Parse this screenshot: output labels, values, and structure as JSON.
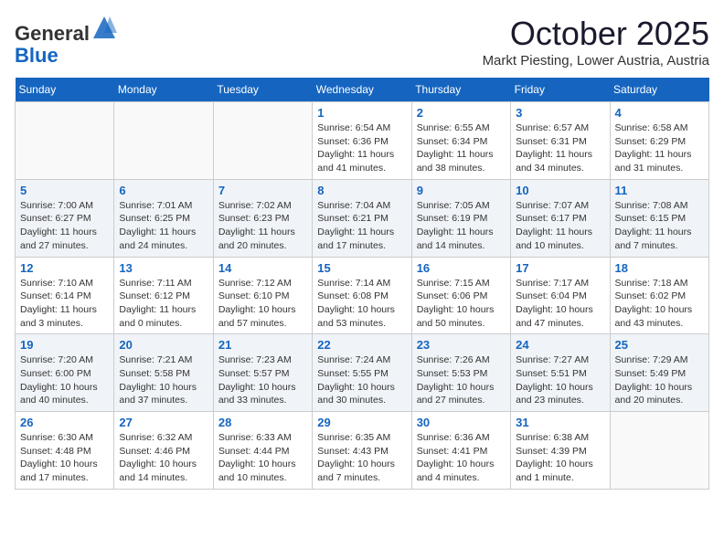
{
  "header": {
    "logo_general": "General",
    "logo_blue": "Blue",
    "month_title": "October 2025",
    "subtitle": "Markt Piesting, Lower Austria, Austria"
  },
  "weekdays": [
    "Sunday",
    "Monday",
    "Tuesday",
    "Wednesday",
    "Thursday",
    "Friday",
    "Saturday"
  ],
  "weeks": [
    [
      {
        "day": "",
        "info": ""
      },
      {
        "day": "",
        "info": ""
      },
      {
        "day": "",
        "info": ""
      },
      {
        "day": "1",
        "info": "Sunrise: 6:54 AM\nSunset: 6:36 PM\nDaylight: 11 hours\nand 41 minutes."
      },
      {
        "day": "2",
        "info": "Sunrise: 6:55 AM\nSunset: 6:34 PM\nDaylight: 11 hours\nand 38 minutes."
      },
      {
        "day": "3",
        "info": "Sunrise: 6:57 AM\nSunset: 6:31 PM\nDaylight: 11 hours\nand 34 minutes."
      },
      {
        "day": "4",
        "info": "Sunrise: 6:58 AM\nSunset: 6:29 PM\nDaylight: 11 hours\nand 31 minutes."
      }
    ],
    [
      {
        "day": "5",
        "info": "Sunrise: 7:00 AM\nSunset: 6:27 PM\nDaylight: 11 hours\nand 27 minutes."
      },
      {
        "day": "6",
        "info": "Sunrise: 7:01 AM\nSunset: 6:25 PM\nDaylight: 11 hours\nand 24 minutes."
      },
      {
        "day": "7",
        "info": "Sunrise: 7:02 AM\nSunset: 6:23 PM\nDaylight: 11 hours\nand 20 minutes."
      },
      {
        "day": "8",
        "info": "Sunrise: 7:04 AM\nSunset: 6:21 PM\nDaylight: 11 hours\nand 17 minutes."
      },
      {
        "day": "9",
        "info": "Sunrise: 7:05 AM\nSunset: 6:19 PM\nDaylight: 11 hours\nand 14 minutes."
      },
      {
        "day": "10",
        "info": "Sunrise: 7:07 AM\nSunset: 6:17 PM\nDaylight: 11 hours\nand 10 minutes."
      },
      {
        "day": "11",
        "info": "Sunrise: 7:08 AM\nSunset: 6:15 PM\nDaylight: 11 hours\nand 7 minutes."
      }
    ],
    [
      {
        "day": "12",
        "info": "Sunrise: 7:10 AM\nSunset: 6:14 PM\nDaylight: 11 hours\nand 3 minutes."
      },
      {
        "day": "13",
        "info": "Sunrise: 7:11 AM\nSunset: 6:12 PM\nDaylight: 11 hours\nand 0 minutes."
      },
      {
        "day": "14",
        "info": "Sunrise: 7:12 AM\nSunset: 6:10 PM\nDaylight: 10 hours\nand 57 minutes."
      },
      {
        "day": "15",
        "info": "Sunrise: 7:14 AM\nSunset: 6:08 PM\nDaylight: 10 hours\nand 53 minutes."
      },
      {
        "day": "16",
        "info": "Sunrise: 7:15 AM\nSunset: 6:06 PM\nDaylight: 10 hours\nand 50 minutes."
      },
      {
        "day": "17",
        "info": "Sunrise: 7:17 AM\nSunset: 6:04 PM\nDaylight: 10 hours\nand 47 minutes."
      },
      {
        "day": "18",
        "info": "Sunrise: 7:18 AM\nSunset: 6:02 PM\nDaylight: 10 hours\nand 43 minutes."
      }
    ],
    [
      {
        "day": "19",
        "info": "Sunrise: 7:20 AM\nSunset: 6:00 PM\nDaylight: 10 hours\nand 40 minutes."
      },
      {
        "day": "20",
        "info": "Sunrise: 7:21 AM\nSunset: 5:58 PM\nDaylight: 10 hours\nand 37 minutes."
      },
      {
        "day": "21",
        "info": "Sunrise: 7:23 AM\nSunset: 5:57 PM\nDaylight: 10 hours\nand 33 minutes."
      },
      {
        "day": "22",
        "info": "Sunrise: 7:24 AM\nSunset: 5:55 PM\nDaylight: 10 hours\nand 30 minutes."
      },
      {
        "day": "23",
        "info": "Sunrise: 7:26 AM\nSunset: 5:53 PM\nDaylight: 10 hours\nand 27 minutes."
      },
      {
        "day": "24",
        "info": "Sunrise: 7:27 AM\nSunset: 5:51 PM\nDaylight: 10 hours\nand 23 minutes."
      },
      {
        "day": "25",
        "info": "Sunrise: 7:29 AM\nSunset: 5:49 PM\nDaylight: 10 hours\nand 20 minutes."
      }
    ],
    [
      {
        "day": "26",
        "info": "Sunrise: 6:30 AM\nSunset: 4:48 PM\nDaylight: 10 hours\nand 17 minutes."
      },
      {
        "day": "27",
        "info": "Sunrise: 6:32 AM\nSunset: 4:46 PM\nDaylight: 10 hours\nand 14 minutes."
      },
      {
        "day": "28",
        "info": "Sunrise: 6:33 AM\nSunset: 4:44 PM\nDaylight: 10 hours\nand 10 minutes."
      },
      {
        "day": "29",
        "info": "Sunrise: 6:35 AM\nSunset: 4:43 PM\nDaylight: 10 hours\nand 7 minutes."
      },
      {
        "day": "30",
        "info": "Sunrise: 6:36 AM\nSunset: 4:41 PM\nDaylight: 10 hours\nand 4 minutes."
      },
      {
        "day": "31",
        "info": "Sunrise: 6:38 AM\nSunset: 4:39 PM\nDaylight: 10 hours\nand 1 minute."
      },
      {
        "day": "",
        "info": ""
      }
    ]
  ]
}
